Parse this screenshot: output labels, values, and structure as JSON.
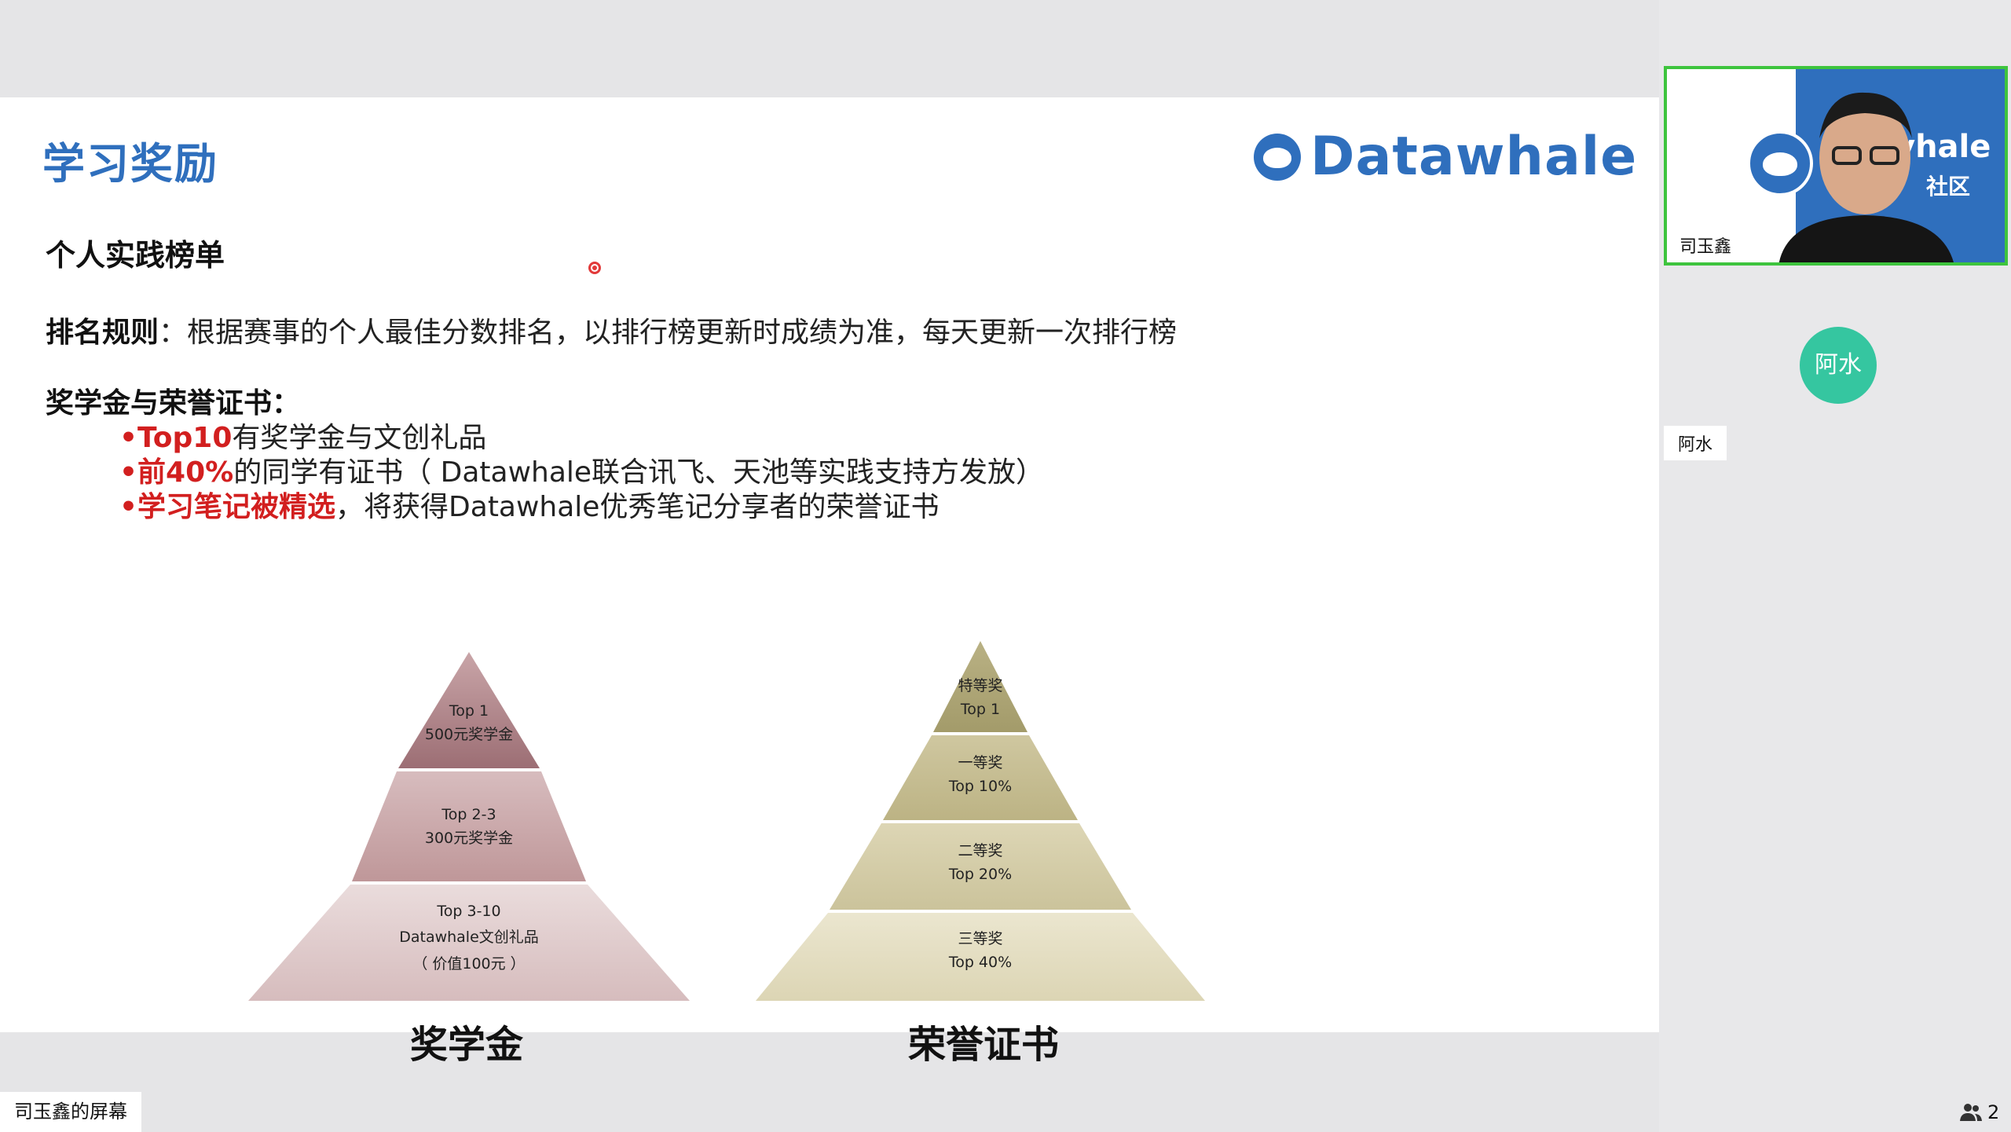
{
  "slide": {
    "title": "学习奖励",
    "logo_text": "Datawhale",
    "subtitle": "个人实践榜单",
    "rule_label": "排名规则",
    "rule_text": "：根据赛事的个人最佳分数排名，以排行榜更新时成绩为准，每天更新一次排行榜",
    "awards_heading": "奖学金与荣誉证书：",
    "bullets": [
      {
        "prefix": "•",
        "highlight": "Top10",
        "rest": "有奖学金与文创礼品"
      },
      {
        "prefix": "•",
        "highlight": "前40%",
        "rest": "的同学有证书（ Datawhale联合讯飞、天池等实践支持方发放）"
      },
      {
        "prefix": "•",
        "highlight": "学习笔记被精选",
        "rest": "，将获得Datawhale优秀笔记分享者的荣誉证书"
      }
    ],
    "pyramid_left": {
      "caption": "奖学金",
      "tiers": [
        {
          "line1": "Top 1",
          "line2": "500元奖学金",
          "line3": ""
        },
        {
          "line1": "Top 2-3",
          "line2": "300元奖学金",
          "line3": ""
        },
        {
          "line1": "Top 3-10",
          "line2": "Datawhale文创礼品",
          "line3": "（ 价值100元 ）"
        }
      ]
    },
    "pyramid_right": {
      "caption": "荣誉证书",
      "tiers": [
        {
          "line1": "特等奖",
          "line2": "Top 1"
        },
        {
          "line1": "一等奖",
          "line2": "Top 10%"
        },
        {
          "line1": "二等奖",
          "line2": "Top 20%"
        },
        {
          "line1": "三等奖",
          "line2": "Top 40%"
        }
      ]
    }
  },
  "screen_owner_label": "司玉鑫的屏幕",
  "participants_panel": {
    "video_tile": {
      "name": "司玉鑫",
      "bg_text1": "vhale",
      "bg_text2": "社区"
    },
    "avatar_tile": {
      "avatar_text": "阿水",
      "name": "阿水"
    },
    "participant_count": "2"
  },
  "colors": {
    "title_blue": "#2f6fbd",
    "highlight_red": "#d21f1f",
    "active_speaker_border": "#3ec43e",
    "avatar_teal": "#35c6a0",
    "scholarship_pyramid": [
      "#a87a80",
      "#c9a5a8",
      "#e6d3d3"
    ],
    "certificate_pyramid": [
      "#a39b6a",
      "#c2ba8e",
      "#d6cfaa",
      "#e6e0c6"
    ]
  },
  "icons": {
    "participants": "people-icon",
    "logo": "whale-logo-icon",
    "pointer": "laser-pointer-icon"
  }
}
